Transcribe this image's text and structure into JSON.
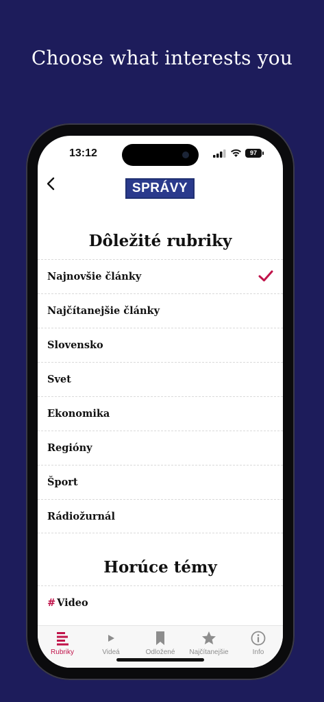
{
  "headline": "Choose what interests you",
  "status_bar": {
    "time": "13:12",
    "battery": "97"
  },
  "header": {
    "back_icon": "chevron-left-icon",
    "logo_text": "SPRÁVY"
  },
  "section1": {
    "title": "Dôležité rubriky",
    "items": [
      {
        "label": "Najnovšie články",
        "checked": true
      },
      {
        "label": "Najčítanejšie články",
        "checked": false
      },
      {
        "label": "Slovensko",
        "checked": false
      },
      {
        "label": "Svet",
        "checked": false
      },
      {
        "label": "Ekonomika",
        "checked": false
      },
      {
        "label": "Regióny",
        "checked": false
      },
      {
        "label": "Šport",
        "checked": false
      },
      {
        "label": "Rádiožurnál",
        "checked": false
      }
    ]
  },
  "section2": {
    "title": "Horúce témy",
    "items": [
      {
        "prefix": "#",
        "label": "Video"
      }
    ]
  },
  "tabbar": {
    "tabs": [
      {
        "label": "Rubriky",
        "icon": "rubriky-icon",
        "active": true
      },
      {
        "label": "Videá",
        "icon": "play-icon",
        "active": false
      },
      {
        "label": "Odložené",
        "icon": "bookmark-icon",
        "active": false
      },
      {
        "label": "Najčítanejšie",
        "icon": "star-icon",
        "active": false
      },
      {
        "label": "Info",
        "icon": "info-icon",
        "active": false
      }
    ]
  },
  "colors": {
    "background": "#1d1c5b",
    "accent": "#c0134a",
    "logo_bg": "#2a3a8c"
  }
}
